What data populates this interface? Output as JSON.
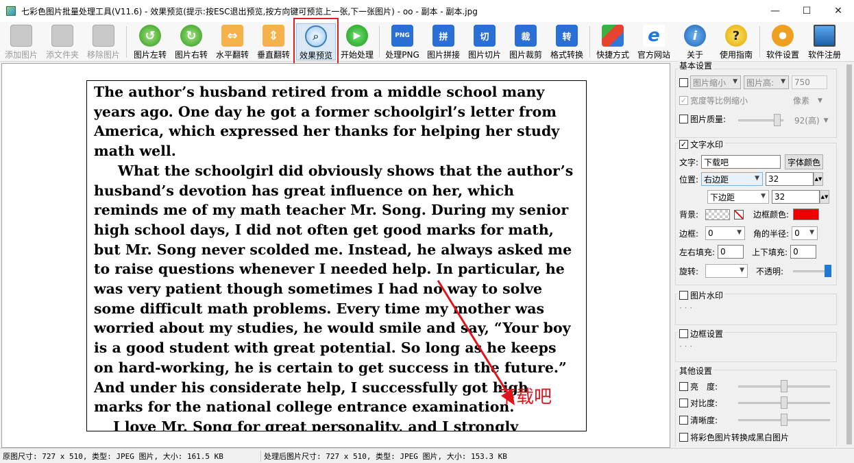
{
  "window": {
    "title": "七彩色图片批量处理工具(V11.6) - 效果预览(提示:按ESC退出预览,按方向键可预览上一张,下一张图片) - oo - 副本 - 副本.jpg",
    "controls": {
      "minimize": "—",
      "maximize": "☐",
      "close": "✕"
    }
  },
  "toolbar": {
    "items": [
      {
        "label": "添加图片",
        "icon": "add-image-icon",
        "enabled": false
      },
      {
        "label": "添文件夹",
        "icon": "add-folder-icon",
        "enabled": false
      },
      {
        "label": "移除图片",
        "icon": "remove-image-icon",
        "enabled": false
      },
      {
        "label": "图片左转",
        "icon": "rotate-left-icon",
        "enabled": true
      },
      {
        "label": "图片右转",
        "icon": "rotate-right-icon",
        "enabled": true
      },
      {
        "label": "水平翻转",
        "icon": "flip-horizontal-icon",
        "enabled": true
      },
      {
        "label": "垂直翻转",
        "icon": "flip-vertical-icon",
        "enabled": true
      },
      {
        "label": "效果预览",
        "icon": "preview-magnifier-icon",
        "enabled": true
      },
      {
        "label": "开始处理",
        "icon": "play-icon",
        "enabled": true
      },
      {
        "label": "处理PNG",
        "icon": "png-icon",
        "glyph": "PNG",
        "enabled": true
      },
      {
        "label": "图片拼接",
        "icon": "stitch-icon",
        "glyph": "拼",
        "enabled": true
      },
      {
        "label": "图片切片",
        "icon": "slice-icon",
        "glyph": "切",
        "enabled": true
      },
      {
        "label": "图片裁剪",
        "icon": "crop-icon",
        "glyph": "裁",
        "enabled": true
      },
      {
        "label": "格式转换",
        "icon": "convert-icon",
        "glyph": "转",
        "enabled": true
      },
      {
        "label": "快捷方式",
        "icon": "shortcut-cubes-icon",
        "enabled": true
      },
      {
        "label": "官方网站",
        "icon": "ie-browser-icon",
        "glyph": "e",
        "enabled": true
      },
      {
        "label": "关于",
        "icon": "info-icon",
        "glyph": "i",
        "enabled": true
      },
      {
        "label": "使用指南",
        "icon": "help-icon",
        "glyph": "?",
        "enabled": true
      },
      {
        "label": "软件设置",
        "icon": "settings-gear-icon",
        "enabled": true
      },
      {
        "label": "软件注册",
        "icon": "register-monitor-icon",
        "enabled": true
      }
    ]
  },
  "preview": {
    "paragraphs": [
      "The author’s husband retired from a middle school many years ago. One day he got a former schoolgirl’s letter from America, which expressed her thanks for helping her study math well.",
      "What the schoolgirl did obviously shows that the author’s husband’s devotion has great influence on her, which reminds me of my math teacher Mr. Song. During my senior high school days, I did not often get good marks for math, but Mr. Song never scolded me. Instead, he always asked me to raise questions whenever I needed help. In particular, he was very patient though sometimes I had no way to solve some difficult math problems. Every time my mother was worried about my studies, he would smile and say, “Your boy is a good student with great potential. So long as he keeps on hard-working, he is certain to get success in the future.” And under his considerate help, I successfully got high marks for the national college entrance examination.",
      "I love Mr. Song for great personality, and I strongly believe that what teachers show to us students can affect our wonderful future greatly."
    ],
    "watermark_text": "下载吧",
    "watermark_color": "#e0141a"
  },
  "panel": {
    "basic": {
      "title": "基本设置",
      "shrink_label": "图片缩小",
      "height_label": "图片高:",
      "height_value": "750",
      "keep_ratio_label": "宽度等比例缩小",
      "unit_label": "像素",
      "quality_label": "图片质量:",
      "quality_value": "92(高)"
    },
    "text_wm": {
      "title": "文字水印",
      "checked": true,
      "text_label": "文字:",
      "text_value": "下载吧",
      "font_color_btn": "字体颜色",
      "position_label": "位置:",
      "pos_x": "右边距",
      "pos_x_val": "32",
      "pos_y": "下边距",
      "pos_y_val": "32",
      "bg_label": "背景:",
      "border_color_label": "边框颜色:",
      "border_color": "#ee0000",
      "border_label": "边框:",
      "border_value": "0",
      "radius_label": "角的半径:",
      "radius_value": "0",
      "pad_lr_label": "左右填充:",
      "pad_lr_value": "0",
      "pad_tb_label": "上下填充:",
      "pad_tb_value": "0",
      "rotate_label": "旋转:",
      "opacity_label": "不透明:",
      "opacity_level": 1.0
    },
    "image_wm": {
      "title": "图片水印",
      "dots": "· · ·"
    },
    "border": {
      "title": "边框设置",
      "dots": "· · ·"
    },
    "other": {
      "title": "其他设置",
      "brightness": "亮　度:",
      "contrast": "对比度:",
      "sharpness": "清晰度:",
      "grayscale": "将彩色图片转换成黑白图片"
    }
  },
  "status": {
    "original": "原图尺寸: 727 x 510, 类型: JPEG 图片, 大小: 161.5 KB",
    "processed": "处理后图片尺寸: 727 x 510, 类型: JPEG 图片, 大小: 153.3 KB"
  }
}
